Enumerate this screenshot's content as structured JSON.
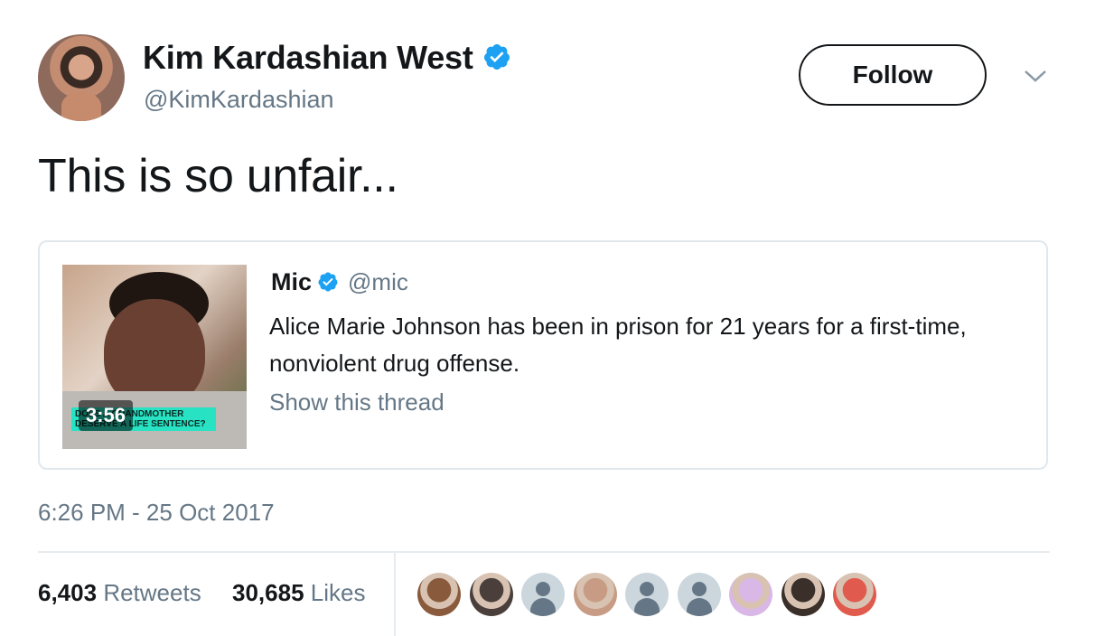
{
  "author": {
    "display_name": "Kim Kardashian West",
    "handle": "@KimKardashian",
    "verified": true
  },
  "follow_label": "Follow",
  "tweet_text": "This is so unfair...",
  "quoted_tweet": {
    "author_name": "Mic",
    "author_handle": "@mic",
    "verified": true,
    "text": "Alice Marie Johnson has been in prison for 21 years for a first-time, nonviolent drug offense.",
    "show_thread_label": "Show this thread",
    "video": {
      "duration": "3:56",
      "banner_text": "DOES A GRANDMOTHER DESERVE A LIFE SENTENCE?"
    }
  },
  "timestamp": "6:26 PM - 25 Oct 2017",
  "stats": {
    "retweets_count": "6,403",
    "retweets_label": "Retweets",
    "likes_count": "30,685",
    "likes_label": "Likes"
  },
  "colors": {
    "verified_blue": "#1da1f2",
    "secondary_text": "#657786",
    "primary_text": "#14171a",
    "border": "#e1e8ed"
  },
  "likers": [
    {
      "kind": "photo",
      "color": "#8a5a3c"
    },
    {
      "kind": "photo",
      "color": "#4a3f3b"
    },
    {
      "kind": "default"
    },
    {
      "kind": "photo",
      "color": "#c89c84"
    },
    {
      "kind": "default"
    },
    {
      "kind": "default"
    },
    {
      "kind": "photo",
      "color": "#d9b7e6"
    },
    {
      "kind": "photo",
      "color": "#3b2f2a"
    },
    {
      "kind": "photo",
      "color": "#e05b4d"
    }
  ]
}
